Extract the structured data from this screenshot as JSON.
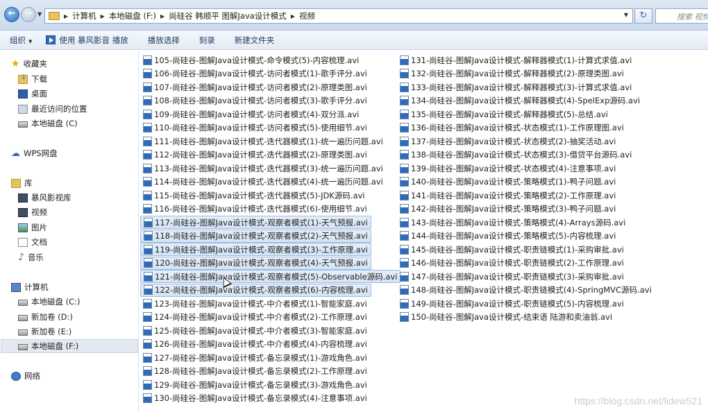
{
  "address": {
    "crumbs": [
      "计算机",
      "本地磁盘 (F:)",
      "尚硅谷 韩顺平 图解Java设计模式",
      "视频"
    ],
    "search_placeholder": "搜索 视频"
  },
  "toolbar": {
    "organize": "组织",
    "play_with": "使用 暴风影音 播放",
    "playlist": "播放选择",
    "burn": "刻录",
    "new_folder": "新建文件夹"
  },
  "nav": {
    "favorites": "收藏夹",
    "downloads": "下载",
    "desktop": "桌面",
    "recent": "最近访问的位置",
    "local_c_fav": "本地磁盘 (C)",
    "wps": "WPS网盘",
    "libraries": "库",
    "baofeng": "暴风影视库",
    "videos": "视频",
    "pictures": "图片",
    "documents": "文档",
    "music": "音乐",
    "computer": "计算机",
    "drive_c": "本地磁盘 (C:)",
    "drive_d": "新加卷 (D:)",
    "drive_e": "新加卷 (E:)",
    "drive_f": "本地磁盘 (F:)",
    "network": "网络"
  },
  "files_col1": [
    "105-尚硅谷-图解Java设计模式-命令模式(5)-内容梳理.avi",
    "106-尚硅谷-图解Java设计模式-访问者模式(1)-歌手评分.avi",
    "107-尚硅谷-图解Java设计模式-访问者模式(2)-原理类图.avi",
    "108-尚硅谷-图解Java设计模式-访问者模式(3)-歌手评分.avi",
    "109-尚硅谷-图解Java设计模式-访问者模式(4)-双分派.avi",
    "110-尚硅谷-图解Java设计模式-访问者模式(5)-使用细节.avi",
    "111-尚硅谷-图解Java设计模式-迭代器模式(1)-统一遍历问题.avi",
    "112-尚硅谷-图解Java设计模式-迭代器模式(2)-原理类图.avi",
    "113-尚硅谷-图解Java设计模式-迭代器模式(3)-统一遍历问题.avi",
    "114-尚硅谷-图解Java设计模式-迭代器模式(4)-统一遍历问题.avi",
    "115-尚硅谷-图解Java设计模式-迭代器模式(5)-JDK源码.avi",
    "116-尚硅谷-图解Java设计模式-迭代器模式(6)-使用细节.avi",
    "117-尚硅谷-图解Java设计模式-观察者模式(1)-天气预报.avi",
    "118-尚硅谷-图解Java设计模式-观察者模式(2)-天气预报.avi",
    "119-尚硅谷-图解Java设计模式-观察者模式(3)-工作原理.avi",
    "120-尚硅谷-图解Java设计模式-观察者模式(4)-天气预报.avi",
    "121-尚硅谷-图解Java设计模式-观察者模式(5)-Observable源码.avi",
    "122-尚硅谷-图解Java设计模式-观察者模式(6)-内容梳理.avi",
    "123-尚硅谷-图解Java设计模式-中介者模式(1)-智能家庭.avi",
    "124-尚硅谷-图解Java设计模式-中介者模式(2)-工作原理.avi",
    "125-尚硅谷-图解Java设计模式-中介者模式(3)-智能家庭.avi",
    "126-尚硅谷-图解Java设计模式-中介者模式(4)-内容梳理.avi",
    "127-尚硅谷-图解Java设计模式-备忘录模式(1)-游戏角色.avi",
    "128-尚硅谷-图解Java设计模式-备忘录模式(2)-工作原理.avi",
    "129-尚硅谷-图解Java设计模式-备忘录模式(3)-游戏角色.avi",
    "130-尚硅谷-图解Java设计模式-备忘录模式(4)-注意事项.avi"
  ],
  "files_col2": [
    "131-尚硅谷-图解Java设计模式-解释器模式(1)-计算式求值.avi",
    "132-尚硅谷-图解Java设计模式-解释器模式(2)-原理类图.avi",
    "133-尚硅谷-图解Java设计模式-解释器模式(3)-计算式求值.avi",
    "134-尚硅谷-图解Java设计模式-解释器模式(4)-SpelExp源码.avi",
    "135-尚硅谷-图解Java设计模式-解释器模式(5)-总结.avi",
    "136-尚硅谷-图解Java设计模式-状态模式(1)-工作原理图.avi",
    "137-尚硅谷-图解Java设计模式-状态模式(2)-抽奖活动.avi",
    "138-尚硅谷-图解Java设计模式-状态模式(3)-借贷平台源码.avi",
    "139-尚硅谷-图解Java设计模式-状态模式(4)-注意事项.avi",
    "140-尚硅谷-图解Java设计模式-策略模式(1)-鸭子问题.avi",
    "141-尚硅谷-图解Java设计模式-策略模式(2)-工作原理.avi",
    "142-尚硅谷-图解Java设计模式-策略模式(3)-鸭子问题.avi",
    "143-尚硅谷-图解Java设计模式-策略模式(4)-Arrays源码.avi",
    "144-尚硅谷-图解Java设计模式-策略模式(5)-内容梳理.avi",
    "145-尚硅谷-图解Java设计模式-职责链模式(1)-采购审批.avi",
    "146-尚硅谷-图解Java设计模式-职责链模式(2)-工作原理.avi",
    "147-尚硅谷-图解Java设计模式-职责链模式(3)-采购审批.avi",
    "148-尚硅谷-图解Java设计模式-职责链模式(4)-SpringMVC源码.avi",
    "149-尚硅谷-图解Java设计模式-职责链模式(5)-内容梳理.avi",
    "150-尚硅谷-图解Java设计模式-结束语 陆游和卖油翁.avi"
  ],
  "watermark": "https://blog.csdn.net/lidew521"
}
